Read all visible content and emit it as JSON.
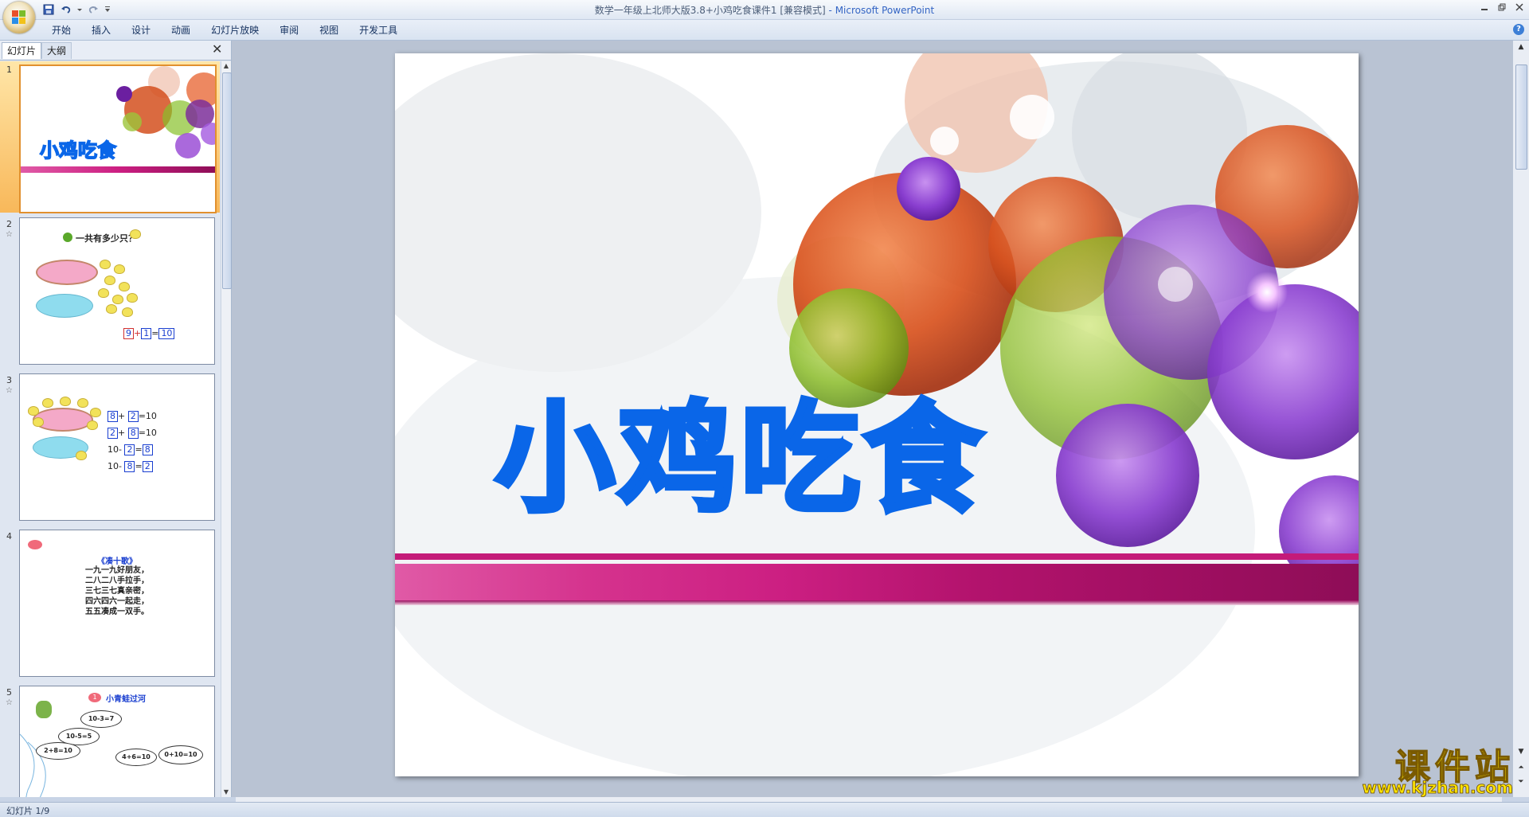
{
  "window": {
    "title": "数学一年级上北师大版3.8+小鸡吃食课件1 [兼容模式]",
    "title_suffix": " - Microsoft PowerPoint"
  },
  "ribbon": {
    "tabs": [
      "开始",
      "插入",
      "设计",
      "动画",
      "幻灯片放映",
      "审阅",
      "视图",
      "开发工具"
    ]
  },
  "panel": {
    "tab_slides": "幻灯片",
    "tab_outline": "大纲",
    "slides": [
      {
        "number": "1",
        "title": "小鸡吃食"
      },
      {
        "number": "2",
        "question": "一共有多少只？",
        "eq": [
          "9",
          "+",
          "1",
          "=",
          "10"
        ]
      },
      {
        "number": "3",
        "eqs": [
          [
            "8",
            "+",
            "2",
            "=10"
          ],
          [
            "2",
            "+",
            "8",
            "=10"
          ],
          [
            "10-",
            "2",
            "=",
            "8"
          ],
          [
            "10-",
            "8",
            "=",
            "2"
          ]
        ]
      },
      {
        "number": "4",
        "poem_title": "《凑十歌》",
        "poem": [
          "一九一九好朋友，",
          "二八二八手拉手，",
          "三七三七真亲密，",
          "四六四六一起走，",
          "五五凑成一双手。"
        ]
      },
      {
        "number": "5",
        "marker": "1",
        "heading": "小青蛙过河",
        "bubbles": [
          "10-3=7",
          "10-5=5",
          "2+8=10",
          "4+6=10",
          "0+10=10"
        ]
      }
    ]
  },
  "slide": {
    "title": "小鸡吃食"
  },
  "status": {
    "text": "幻灯片 1/9"
  },
  "watermark": {
    "name": "课件站",
    "url": "www.kjzhan.com"
  },
  "colors": {
    "title_blue": "#0a66e8",
    "band_magenta": "#cc1f82",
    "selection_orange": "#f8b85a"
  }
}
